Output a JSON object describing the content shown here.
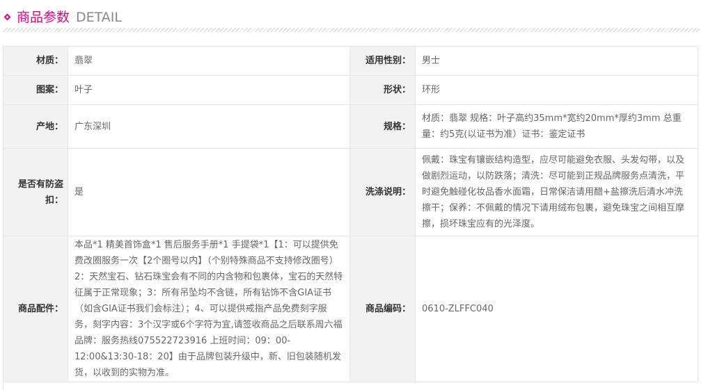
{
  "header": {
    "title_cn": "商品参数",
    "title_en": "DETAIL"
  },
  "rows": {
    "material_label": "材质：",
    "material_value": "翡翠",
    "gender_label": "适用性别：",
    "gender_value": "男士",
    "pattern_label": "图案：",
    "pattern_value": "叶子",
    "shape_label": "形状：",
    "shape_value": "环形",
    "origin_label": "产地：",
    "origin_value": "广东深圳",
    "spec_label": "规格：",
    "spec_value": "材质：翡翠 规格：叶子高约35mm*宽约20mm*厚约3mm 总重量：约5克(以证书为准）证书：鉴定证书",
    "antitheft_label": "是否有防盗扣：",
    "antitheft_value": "是",
    "care_label": "洗涤说明：",
    "care_value": "佩戴：珠宝有镶嵌结构造型，应尽可能避免衣服、头发勾带，以及做剧烈运动，以防跌落；清洗：尽可能到正规品牌服务点清洗，平时避免触碰化妆品香水面霜，日常保洁请用醋+盐擦洗后清水冲洗擦干；保养：不佩戴的情况下请用绒布包裹，避免珠宝之间相互摩擦，损坏珠宝应有的光泽度。",
    "accessories_label": "商品配件：",
    "accessories_value": "本品*1 精美首饰盒*1 售后服务手册*1 手提袋*1【1：可以提供免费改圈服务一次【2个圈号以内】（个别特殊商品不支持修改圈号）2：天然宝石、钻石珠宝会有不同的内含物和包裹体，宝石的天然特征属于正常现象；3：所有吊坠均不含链，所有钻饰不含GIA证书（如含GIA证书我们会标注）；4、可以提供戒指产品免费刻字服务，刻字内容：3个汉字或6个字符为宜,请签收商品之后联系周六福品牌：服务热线075522723916 上班时间：09：00-12:00&13:30-18：20】由于品牌包装升级中，新、旧包装随机发货，以收到的实物为准。",
    "code_label": "商品编码：",
    "code_value": "0610-ZLFFC040"
  },
  "colors": {
    "accent": "#e4007f",
    "label_bg": "#f2f2f2",
    "border": "#e6e6e6"
  }
}
